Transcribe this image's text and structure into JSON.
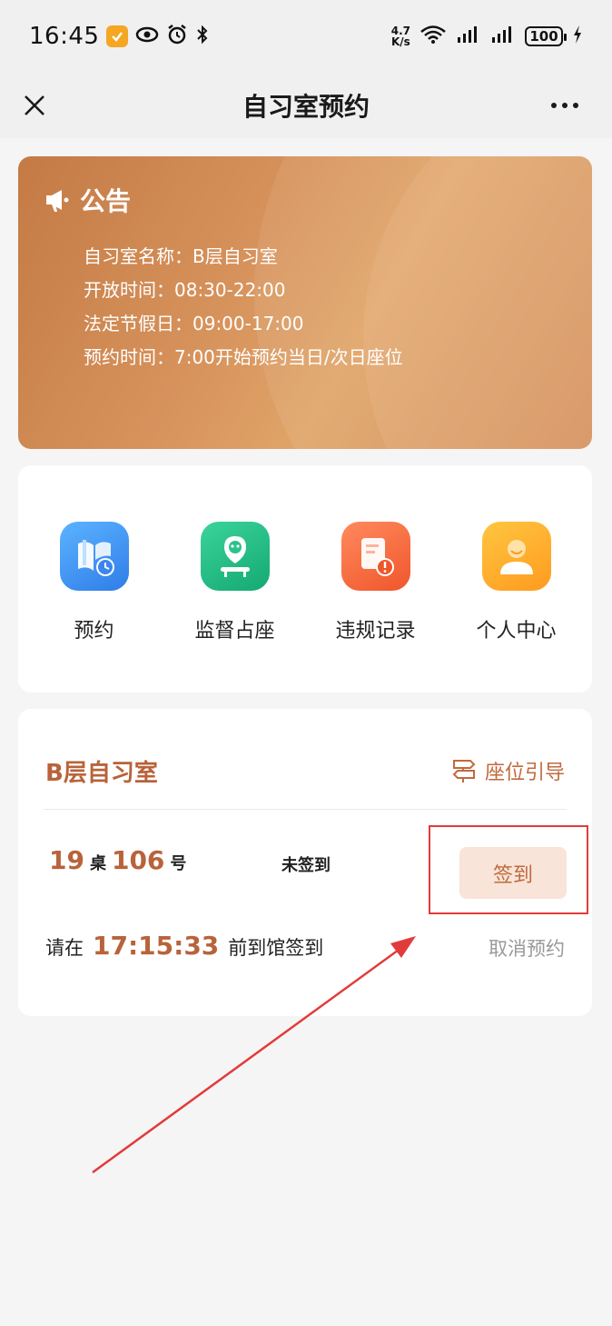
{
  "status_bar": {
    "time": "16:45",
    "speed_top": "4.7",
    "speed_bottom": "K/s",
    "battery": "100",
    "icons": [
      "app-icon",
      "eye-icon",
      "alarm-icon",
      "bluetooth-icon",
      "wifi-icon",
      "signal-icon",
      "signal-icon",
      "charging-icon"
    ]
  },
  "titlebar": {
    "title": "自习室预约",
    "close_icon": "close-icon",
    "more_icon": "more-icon"
  },
  "notice": {
    "title": "公告",
    "icon": "megaphone-icon",
    "lines": [
      "自习室名称：B层自习室",
      "开放时间：08:30-22:00",
      "法定节假日：09:00-17:00",
      "预约时间：7:00开始预约当日/次日座位"
    ]
  },
  "menu": [
    {
      "label": "预约",
      "icon": "book-clock-icon",
      "color": "#2f7de8"
    },
    {
      "label": "监督占座",
      "icon": "location-seat-icon",
      "color": "#15a873"
    },
    {
      "label": "违规记录",
      "icon": "document-warning-icon",
      "color": "#f0562b"
    },
    {
      "label": "个人中心",
      "icon": "user-icon",
      "color": "#ff9a1f"
    }
  ],
  "reservation": {
    "room_name": "B层自习室",
    "seat_guide_label": "座位引导",
    "desk_number": "19",
    "desk_unit": "桌",
    "seat_number": "106",
    "seat_unit": "号",
    "status": "未签到",
    "checkin_label": "签到",
    "hint_before": "请在",
    "countdown": "17:15:33",
    "hint_after": "前到馆签到",
    "cancel_label": "取消预约"
  },
  "colors": {
    "accent": "#b8633a",
    "annotation": "#e23b3b"
  }
}
